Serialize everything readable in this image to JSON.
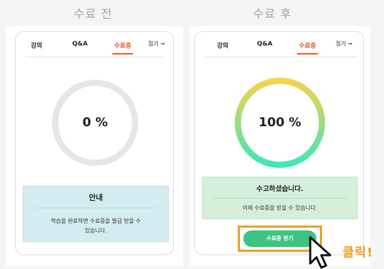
{
  "before": {
    "heading": "수료 전",
    "tabs": [
      {
        "label": "강의"
      },
      {
        "label": "Q&A"
      },
      {
        "label": "수료증",
        "active": true
      }
    ],
    "fold_label": "접기",
    "fold_arrow": "→",
    "progress": {
      "value": 0,
      "label": "0 %"
    },
    "notice": {
      "title": "안내",
      "body_line1": "학습을 완료하면 수료증을 발급 받을 수",
      "body_line2": "있습니다."
    }
  },
  "after": {
    "heading": "수료 후",
    "tabs": [
      {
        "label": "강의"
      },
      {
        "label": "Q&A"
      },
      {
        "label": "수료증",
        "active": true
      }
    ],
    "fold_label": "접기",
    "fold_arrow": "→",
    "progress": {
      "value": 100,
      "label": "100 %"
    },
    "notice": {
      "title": "수고하셨습니다.",
      "body": "이제 수료증을 받을 수 있습니다."
    },
    "button_label": "수료증 받기",
    "callout": "클릭!"
  },
  "colors": {
    "accent": "#e8542f",
    "ring_track": "#e6e6e6",
    "ring_gradient_start": "#3ee8b5",
    "ring_gradient_end": "#f4d44c",
    "info_bg": "#d3ecef",
    "info_border": "#bfe0e5",
    "success_bg": "#d5efdb",
    "success_border": "#c2e5cb",
    "button": "#3cc482",
    "highlight": "#f29a1f"
  },
  "icons": {
    "fold": "arrow-right-icon",
    "pointer": "cursor-pointer-icon"
  }
}
